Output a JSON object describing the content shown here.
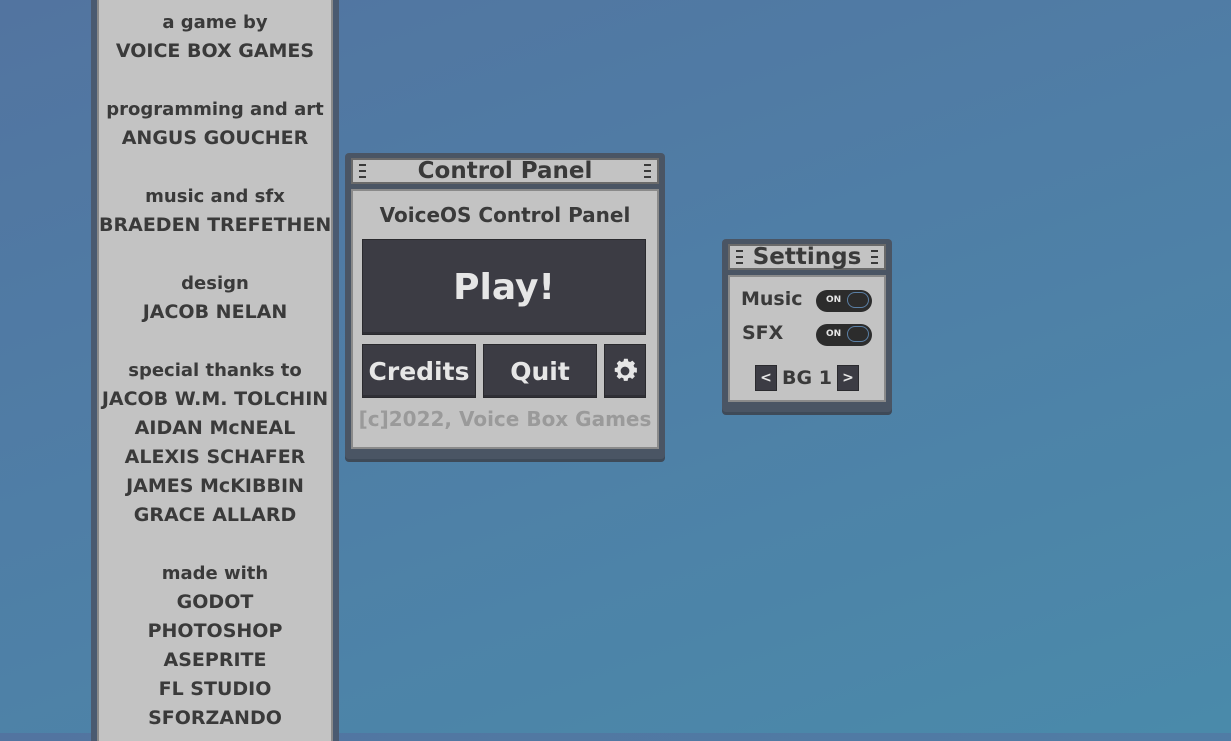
{
  "credits": {
    "blocks": [
      {
        "heading": "a game by",
        "names": [
          "VOICE BOX GAMES"
        ]
      },
      {
        "heading": "programming and art",
        "names": [
          "ANGUS GOUCHER"
        ]
      },
      {
        "heading": "music and sfx",
        "names": [
          "BRAEDEN TREFETHEN"
        ]
      },
      {
        "heading": "design",
        "names": [
          "JACOB NELAN"
        ]
      },
      {
        "heading": "special thanks to",
        "names": [
          "JACOB W.M. TOLCHIN",
          "AIDAN McNEAL",
          "ALEXIS SCHAFER",
          "JAMES McKIBBIN",
          "GRACE ALLARD"
        ]
      },
      {
        "heading": "made with",
        "names": [
          "GODOT",
          "PHOTOSHOP",
          "ASEPRITE",
          "FL STUDIO",
          "SFORZANDO"
        ]
      }
    ]
  },
  "control_panel": {
    "title": "Control Panel",
    "subtitle": "VoiceOS Control Panel",
    "play_label": "Play!",
    "credits_label": "Credits",
    "quit_label": "Quit",
    "settings_icon": "gear-icon",
    "copyright": "[c]2022, Voice Box Games"
  },
  "settings": {
    "title": "Settings",
    "music_label": "Music",
    "music_state": "ON",
    "sfx_label": "SFX",
    "sfx_state": "ON",
    "prev_label": "<",
    "next_label": ">",
    "bg_label": "BG 1"
  },
  "colors": {
    "panel_bg": "#c3c3c3",
    "button_bg": "#3c3c44",
    "window_frame": "#4a5564",
    "text_dark": "#3a3a3a",
    "copyright_text": "#9a9a9a"
  }
}
